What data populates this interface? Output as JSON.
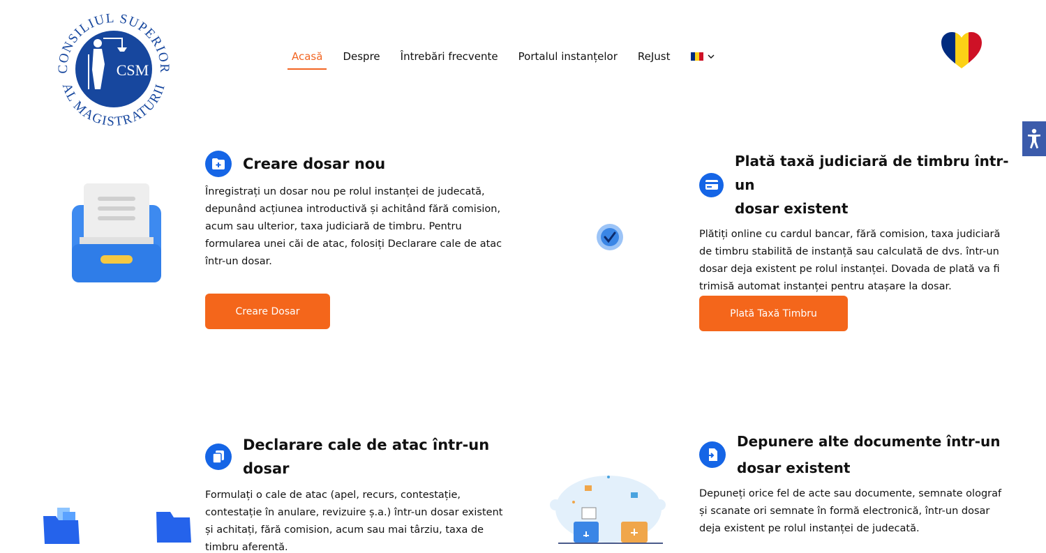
{
  "header": {
    "logo": {
      "arc_text_top": "CONSILIUL SUPERIOR",
      "arc_text_bottom": "AL MAGISTRATURII",
      "monogram": "CSM"
    },
    "nav": [
      {
        "label": "Acasă",
        "active": true
      },
      {
        "label": "Despre",
        "active": false
      },
      {
        "label": "Întrebări frecvente",
        "active": false
      },
      {
        "label": "Portalul instanțelor",
        "active": false
      },
      {
        "label": "ReJust",
        "active": false
      }
    ],
    "language": {
      "flag_colors": [
        "#002b7f",
        "#fcd116",
        "#ce1126"
      ],
      "icon": "chevron-down-icon"
    }
  },
  "colors": {
    "accent": "#f26522",
    "button": "#f4661b",
    "icon_blue": "#1565e6"
  },
  "cards": [
    {
      "title": "Creare dosar nou",
      "description_lines": [
        "Înregistrați un dosar nou pe rolul instanței de judecată,",
        "depunând acțiunea introductivă și achitând fără comision,",
        "acum sau ulterior, taxa judiciară de timbru. Pentru",
        "formularea unei căi de atac, folosiți Declarare cale de atac",
        "într-un dosar."
      ],
      "button": "Creare Dosar",
      "icon": "folder-plus-icon"
    },
    {
      "title_lines": [
        "Plată taxă judiciară de timbru într-un",
        "dosar existent"
      ],
      "description_lines": [
        "Plătiți online cu cardul bancar, fără comision, taxa judiciară",
        "de timbru stabilită de instanță sau calculată de dvs. într-un",
        "dosar deja existent pe rolul instanței. Dovada de plată va fi",
        "trimisă automat instanței pentru atașare la dosar."
      ],
      "button": "Plată Taxă Timbru",
      "icon": "credit-card-icon"
    },
    {
      "title": "Declarare cale de atac într-un dosar",
      "description_lines": [
        "Formulați o cale de atac (apel, recurs, contestație,",
        "contestație în anulare, revizuire ș.a.) într-un dosar existent",
        "și achitați, fără comision, acum sau mai târziu, taxa de",
        "timbru aferentă."
      ],
      "icon": "copy-icon"
    },
    {
      "title_lines": [
        "Depunere alte documente într-un",
        "dosar existent"
      ],
      "description_lines": [
        "Depuneți orice fel de acte sau documente, semnate olograf",
        "și scanate ori semnate în formă electronică, într-un dosar",
        "deja existent pe rolul instanței de judecată."
      ],
      "icon": "file-import-icon"
    }
  ]
}
